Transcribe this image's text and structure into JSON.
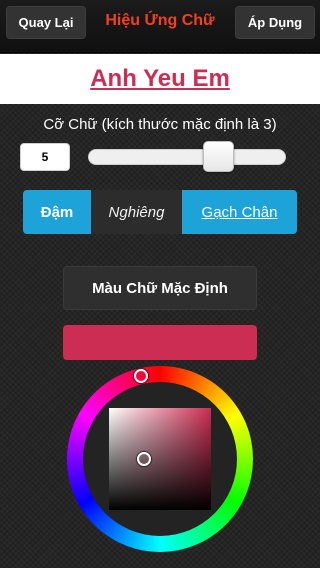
{
  "navbar": {
    "back_label": "Quay Lại",
    "title": "Hiệu Ứng Chữ",
    "apply_label": "Áp Dụng",
    "title_color": "#f5401e"
  },
  "preview": {
    "text": "Anh Yeu Em",
    "color": "#cc2d52"
  },
  "font_size": {
    "label": "Cỡ Chữ (kích thước mặc định là 3)",
    "value": "5",
    "slider_fraction": 0.73
  },
  "style_segment": {
    "bold_label": "Đậm",
    "italic_label": "Nghiêng",
    "underline_label": "Gạch Chân",
    "active_color": "#1ea3d8",
    "selected": [
      "bold",
      "underline"
    ]
  },
  "color_picker": {
    "default_button_label": "Màu Chữ Mặc Định",
    "current_color": "#cc2d52",
    "hue_degrees": 345
  }
}
